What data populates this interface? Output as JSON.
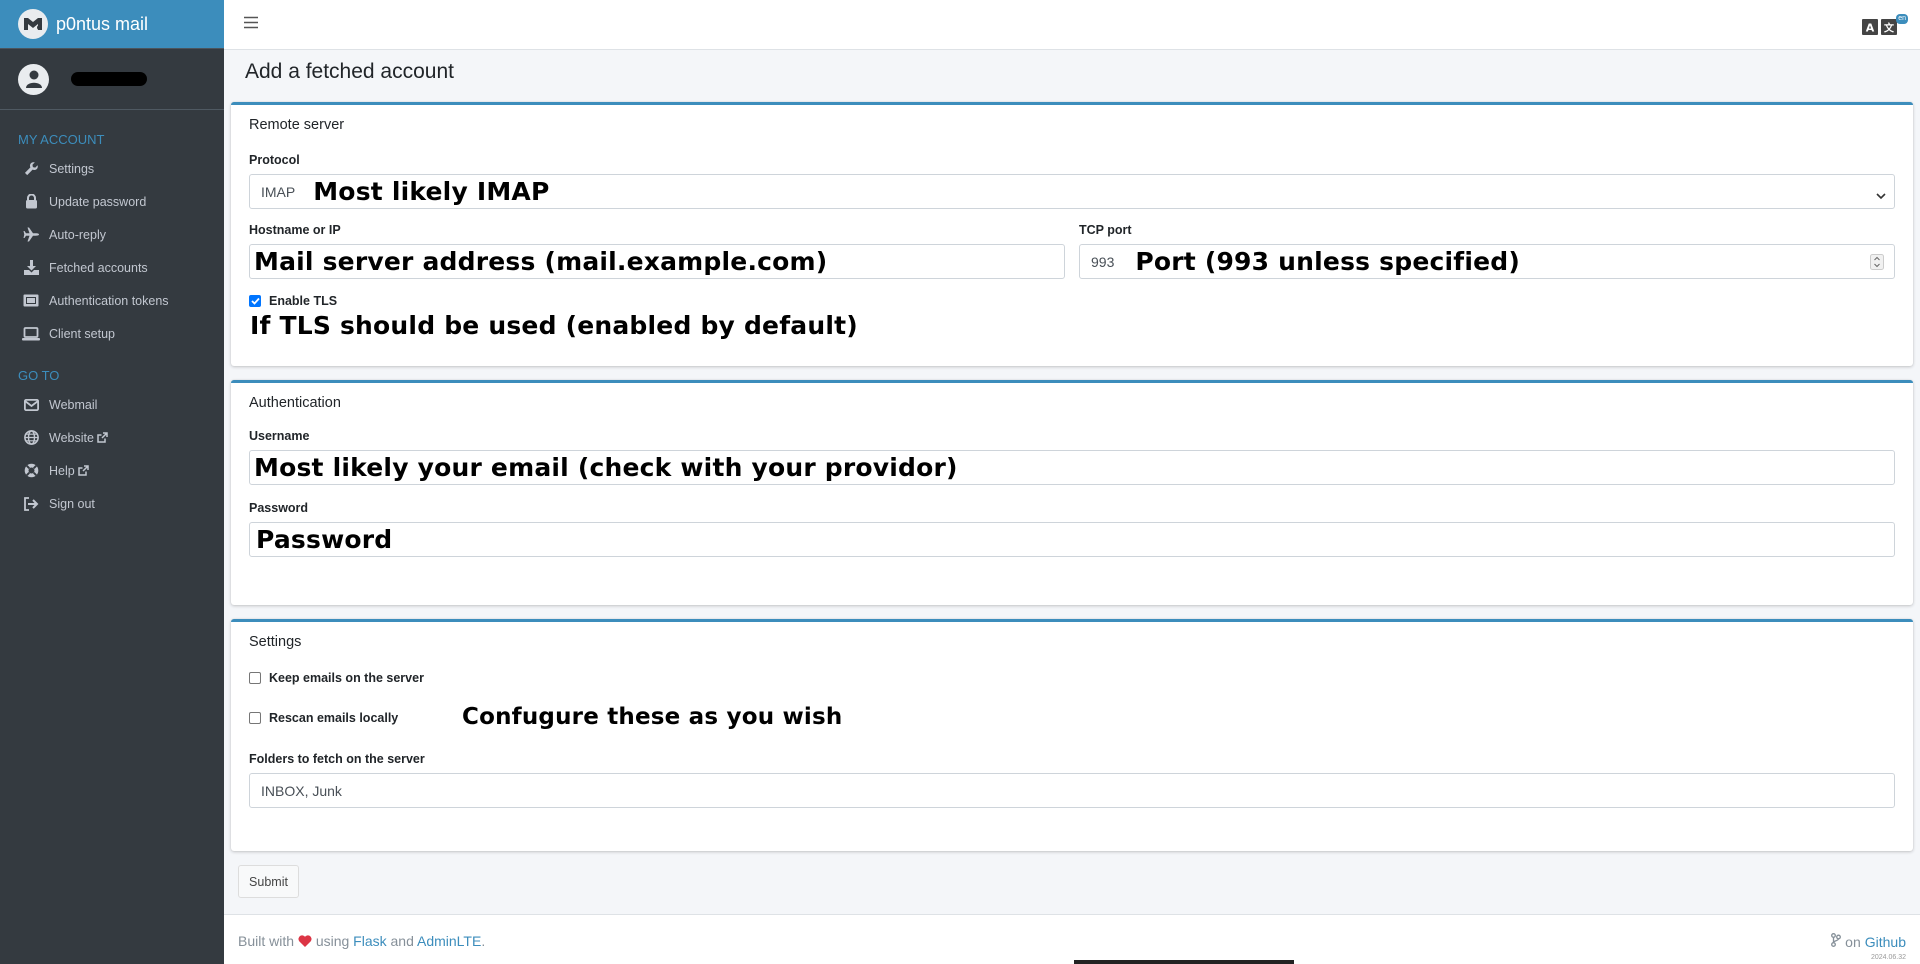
{
  "brand": {
    "title": "p0ntus mail"
  },
  "sidebar": {
    "sections": [
      {
        "header": "MY ACCOUNT",
        "items": [
          {
            "label": "Settings",
            "icon": "wrench-icon"
          },
          {
            "label": "Update password",
            "icon": "lock-icon"
          },
          {
            "label": "Auto-reply",
            "icon": "plane-icon"
          },
          {
            "label": "Fetched accounts",
            "icon": "download-icon"
          },
          {
            "label": "Authentication tokens",
            "icon": "ticket-icon"
          },
          {
            "label": "Client setup",
            "icon": "laptop-icon"
          }
        ]
      },
      {
        "header": "GO TO",
        "items": [
          {
            "label": "Webmail",
            "icon": "envelope-icon"
          },
          {
            "label": "Website",
            "icon": "globe-icon",
            "external": true
          },
          {
            "label": "Help",
            "icon": "lifering-icon",
            "external": true
          },
          {
            "label": "Sign out",
            "icon": "sign-out-icon"
          }
        ]
      }
    ]
  },
  "topbar": {
    "lang_badge": "en"
  },
  "page": {
    "title": "Add a fetched account"
  },
  "remote_server": {
    "header": "Remote server",
    "protocol_label": "Protocol",
    "protocol_value": "IMAP",
    "protocol_note": "Most likely IMAP",
    "hostname_label": "Hostname or IP",
    "hostname_note": "Mail server address (mail.example.com)",
    "port_label": "TCP port",
    "port_value": "993",
    "port_note": "Port (993 unless specified)",
    "tls_label": "Enable TLS",
    "tls_checked": true,
    "tls_note": "If TLS should be used (enabled by default)"
  },
  "authentication": {
    "header": "Authentication",
    "username_label": "Username",
    "username_note": "Most likely your email (check with your providor)",
    "password_label": "Password",
    "password_note": "Password"
  },
  "settings": {
    "header": "Settings",
    "keep_label": "Keep emails on the server",
    "rescan_label": "Rescan emails locally",
    "settings_note": "Confugure these as you wish",
    "folders_label": "Folders to fetch on the server",
    "folders_value": "INBOX, Junk"
  },
  "submit_label": "Submit",
  "footer": {
    "built_with": "Built with",
    "using": "using",
    "flask": "Flask",
    "and": "and",
    "adminlte": "AdminLTE",
    "dot": ".",
    "on": "on",
    "github": "Github",
    "version": "2024.06.32"
  }
}
